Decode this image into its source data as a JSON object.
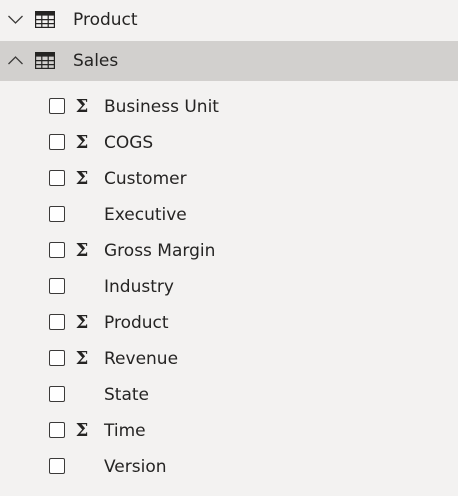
{
  "tables": [
    {
      "name": "Product",
      "expanded": false,
      "chevron_icon": "chevron-down-icon",
      "icon": "table-icon"
    },
    {
      "name": "Sales",
      "expanded": true,
      "chevron_icon": "chevron-up-icon",
      "icon": "table-icon",
      "fields": [
        {
          "label": "Business Unit",
          "aggregate": true,
          "checked": false
        },
        {
          "label": "COGS",
          "aggregate": true,
          "checked": false
        },
        {
          "label": "Customer",
          "aggregate": true,
          "checked": false
        },
        {
          "label": "Executive",
          "aggregate": false,
          "checked": false
        },
        {
          "label": "Gross Margin",
          "aggregate": true,
          "checked": false
        },
        {
          "label": "Industry",
          "aggregate": false,
          "checked": false
        },
        {
          "label": "Product",
          "aggregate": true,
          "checked": false
        },
        {
          "label": "Revenue",
          "aggregate": true,
          "checked": false
        },
        {
          "label": "State",
          "aggregate": false,
          "checked": false
        },
        {
          "label": "Time",
          "aggregate": true,
          "checked": false
        },
        {
          "label": "Version",
          "aggregate": false,
          "checked": false
        }
      ]
    }
  ],
  "aggregate_symbol": "Σ",
  "colors": {
    "background": "#f3f2f1",
    "selected_row": "#d2d0ce",
    "text": "#252423"
  }
}
